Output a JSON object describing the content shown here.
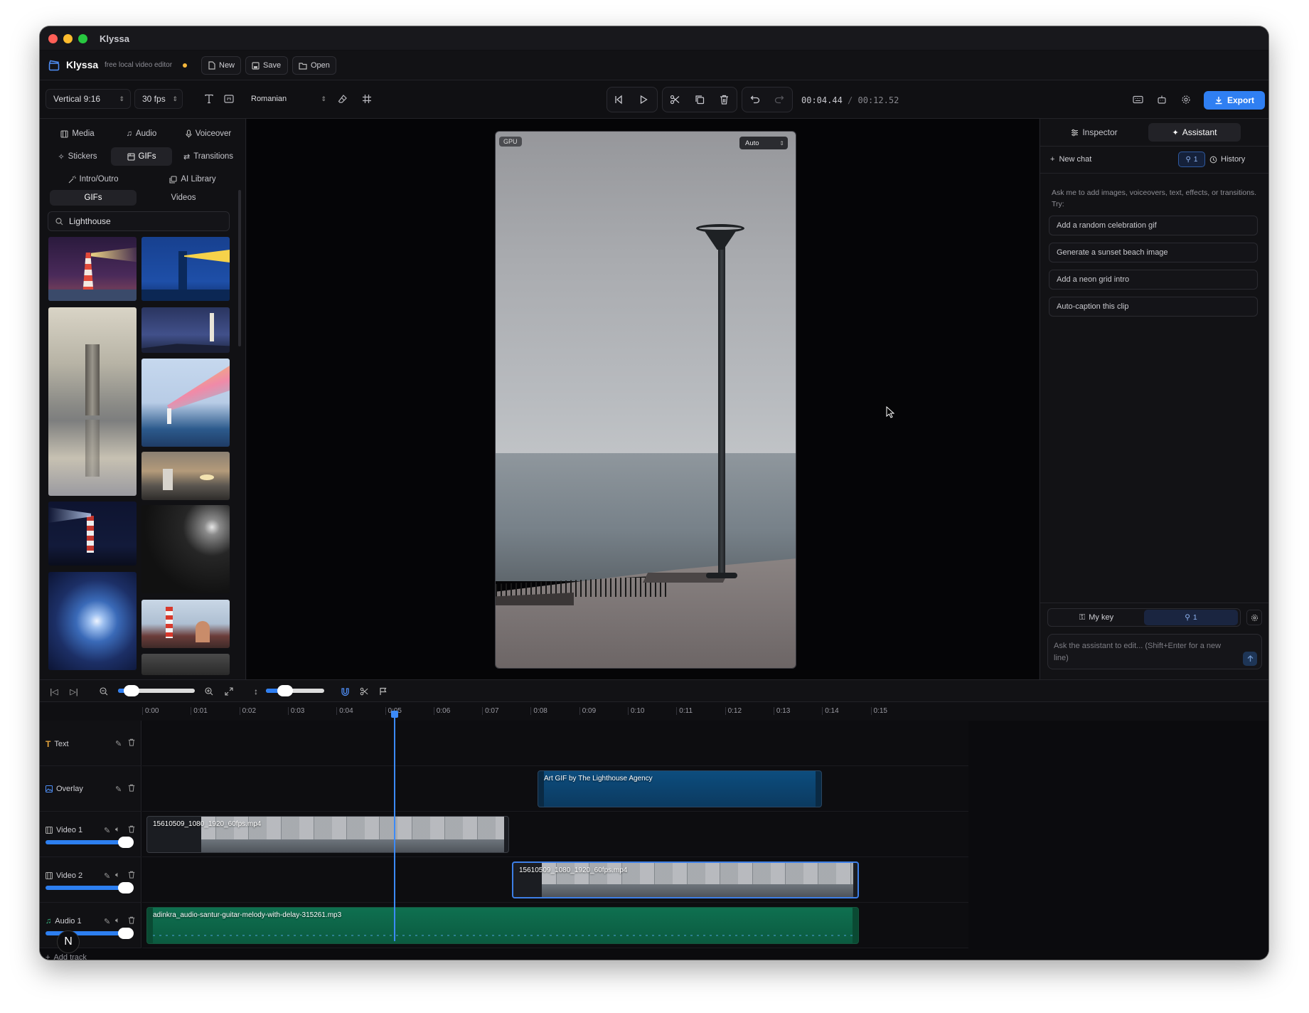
{
  "window": {
    "title": "Klyssa"
  },
  "app": {
    "name": "Klyssa",
    "tagline": "free local video editor",
    "buttons": {
      "new": "New",
      "save": "Save",
      "open": "Open"
    }
  },
  "toolbar": {
    "aspect": "Vertical 9:16",
    "fps": "30 fps",
    "language": "Romanian",
    "time_current": "00:04.44",
    "time_sep": "/",
    "time_total": "00:12.52",
    "export_label": "Export"
  },
  "left_panel": {
    "tabs_row1": [
      "Media",
      "Audio",
      "Voiceover"
    ],
    "tabs_row2": [
      "Stickers",
      "GIFs",
      "Transitions"
    ],
    "tabs_row3": [
      "Intro/Outro",
      "AI Library"
    ],
    "subtabs": [
      "GIFs",
      "Videos"
    ],
    "active_tab": "GIFs",
    "search_value": "Lighthouse"
  },
  "preview": {
    "badge": "GPU",
    "quality": "Auto"
  },
  "right_panel": {
    "tabs": [
      "Inspector",
      "Assistant"
    ],
    "active_tab": "Assistant",
    "new_chat": "New chat",
    "link_count": "1",
    "history": "History",
    "intro": "Ask me to add images, voiceovers, text, effects, or transitions. Try:",
    "suggestions": [
      "Add a random celebration gif",
      "Generate a sunset beach image",
      "Add a neon grid intro",
      "Auto-caption this clip"
    ],
    "key_label": "My key",
    "key_count": "1",
    "input_placeholder": "Ask the assistant to edit... (Shift+Enter for a new line)"
  },
  "timeline": {
    "ruler": [
      "0:00",
      "0:01",
      "0:02",
      "0:03",
      "0:04",
      "0:05",
      "0:06",
      "0:07",
      "0:08",
      "0:09",
      "0:10",
      "0:11",
      "0:12",
      "0:13",
      "0:14",
      "0:15"
    ],
    "playhead_time": "0:04.44",
    "tracks": [
      {
        "name": "Text"
      },
      {
        "name": "Overlay"
      },
      {
        "name": "Video 1"
      },
      {
        "name": "Video 2"
      },
      {
        "name": "Audio 1"
      }
    ],
    "clips": {
      "overlay": "Art GIF by The Lighthouse Agency",
      "video1": "15610509_1080_1920_60fps.mp4",
      "video2": "15610509_1080_1920_60fps.mp4",
      "audio": "adinkra_audio-santur-guitar-melody-with-delay-315261.mp3"
    },
    "add_track": "Add track"
  },
  "avatar": {
    "initial": "N"
  },
  "colors": {
    "accent": "#2f7ff2",
    "overlay_clip": "#0d4d7e",
    "audio_clip": "#0d6b48",
    "save_dot": "#f5b73b"
  }
}
